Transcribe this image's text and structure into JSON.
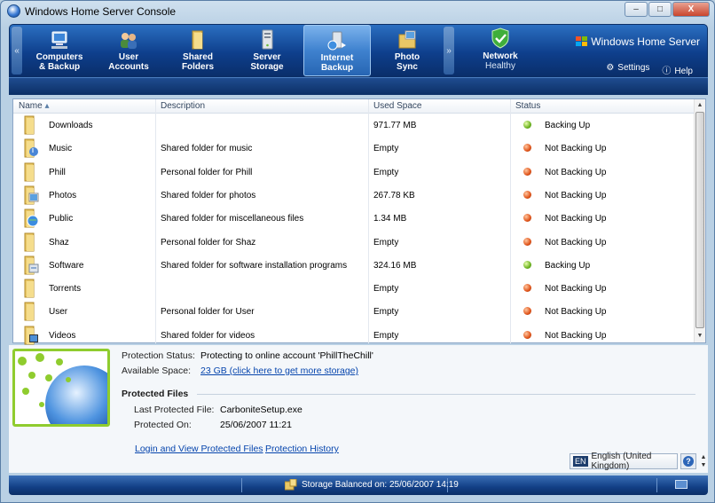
{
  "window": {
    "title": "Windows Home Server Console",
    "controls": {
      "minimize": "–",
      "maximize": "□",
      "close": "X"
    }
  },
  "nav": {
    "scroll_left": "«",
    "scroll_right": "»",
    "tabs": [
      {
        "line1": "Computers",
        "line2": "& Backup",
        "icon": "computer-icon"
      },
      {
        "line1": "User",
        "line2": "Accounts",
        "icon": "users-icon"
      },
      {
        "line1": "Shared",
        "line2": "Folders",
        "icon": "folder-icon"
      },
      {
        "line1": "Server",
        "line2": "Storage",
        "icon": "server-icon"
      },
      {
        "line1": "Internet",
        "line2": "Backup",
        "icon": "internet-backup-icon",
        "active": true
      },
      {
        "line1": "Photo",
        "line2": "Sync",
        "icon": "photo-folder-icon"
      }
    ],
    "network": {
      "label": "Network",
      "status": "Healthy"
    },
    "brand": "Windows Home Server",
    "settings": "Settings",
    "help": "Help"
  },
  "table": {
    "columns": {
      "name": "Name",
      "sort_indicator": "▴",
      "description": "Description",
      "used": "Used Space",
      "status": "Status"
    },
    "rows": [
      {
        "name": "Downloads",
        "description": "",
        "used": "971.77 MB",
        "status": "Backing Up",
        "ok": true,
        "icon": "folder-icon"
      },
      {
        "name": "Music",
        "description": "Shared folder for music",
        "used": "Empty",
        "status": "Not Backing Up",
        "ok": false,
        "icon": "music-folder-icon"
      },
      {
        "name": "Phill",
        "description": "Personal folder for Phill",
        "used": "Empty",
        "status": "Not Backing Up",
        "ok": false,
        "icon": "folder-icon"
      },
      {
        "name": "Photos",
        "description": "Shared folder for photos",
        "used": "267.78 KB",
        "status": "Not Backing Up",
        "ok": false,
        "icon": "photos-folder-icon"
      },
      {
        "name": "Public",
        "description": "Shared folder for miscellaneous files",
        "used": "1.34 MB",
        "status": "Not Backing Up",
        "ok": false,
        "icon": "globe-folder-icon"
      },
      {
        "name": "Shaz",
        "description": "Personal folder for Shaz",
        "used": "Empty",
        "status": "Not Backing Up",
        "ok": false,
        "icon": "folder-icon"
      },
      {
        "name": "Software",
        "description": "Shared folder for software installation programs",
        "used": "324.16 MB",
        "status": "Backing Up",
        "ok": true,
        "icon": "software-folder-icon"
      },
      {
        "name": "Torrents",
        "description": "",
        "used": "Empty",
        "status": "Not Backing Up",
        "ok": false,
        "icon": "folder-icon"
      },
      {
        "name": "User",
        "description": "Personal folder for User",
        "used": "Empty",
        "status": "Not Backing Up",
        "ok": false,
        "icon": "folder-icon"
      },
      {
        "name": "Videos",
        "description": "Shared folder for videos",
        "used": "Empty",
        "status": "Not Backing Up",
        "ok": false,
        "icon": "video-folder-icon"
      }
    ],
    "scroll_up": "▲",
    "scroll_down": "▼"
  },
  "details": {
    "protection_status_label": "Protection Status:",
    "protection_status_value": "Protecting to online account 'PhillTheChill'",
    "available_space_label": "Available Space:",
    "available_space_value": "23 GB (click here to get more storage)",
    "protected_files_title": "Protected Files",
    "last_file_label": "Last Protected File:",
    "last_file_value": "CarboniteSetup.exe",
    "protected_on_label": "Protected On:",
    "protected_on_value": "25/06/2007 11:21",
    "login_link": "Login and View Protected Files",
    "history_link": "Protection History"
  },
  "language": {
    "code": "EN",
    "name": "English (United Kingdom)",
    "help": "?"
  },
  "statusbar": {
    "text": "Storage Balanced on: 25/06/2007 14:19"
  },
  "colors": {
    "accent": "#0e3f8c",
    "ok": "#6db321",
    "bad": "#e0541a",
    "link": "#0645ad",
    "globe_border": "#8fcc2e"
  }
}
